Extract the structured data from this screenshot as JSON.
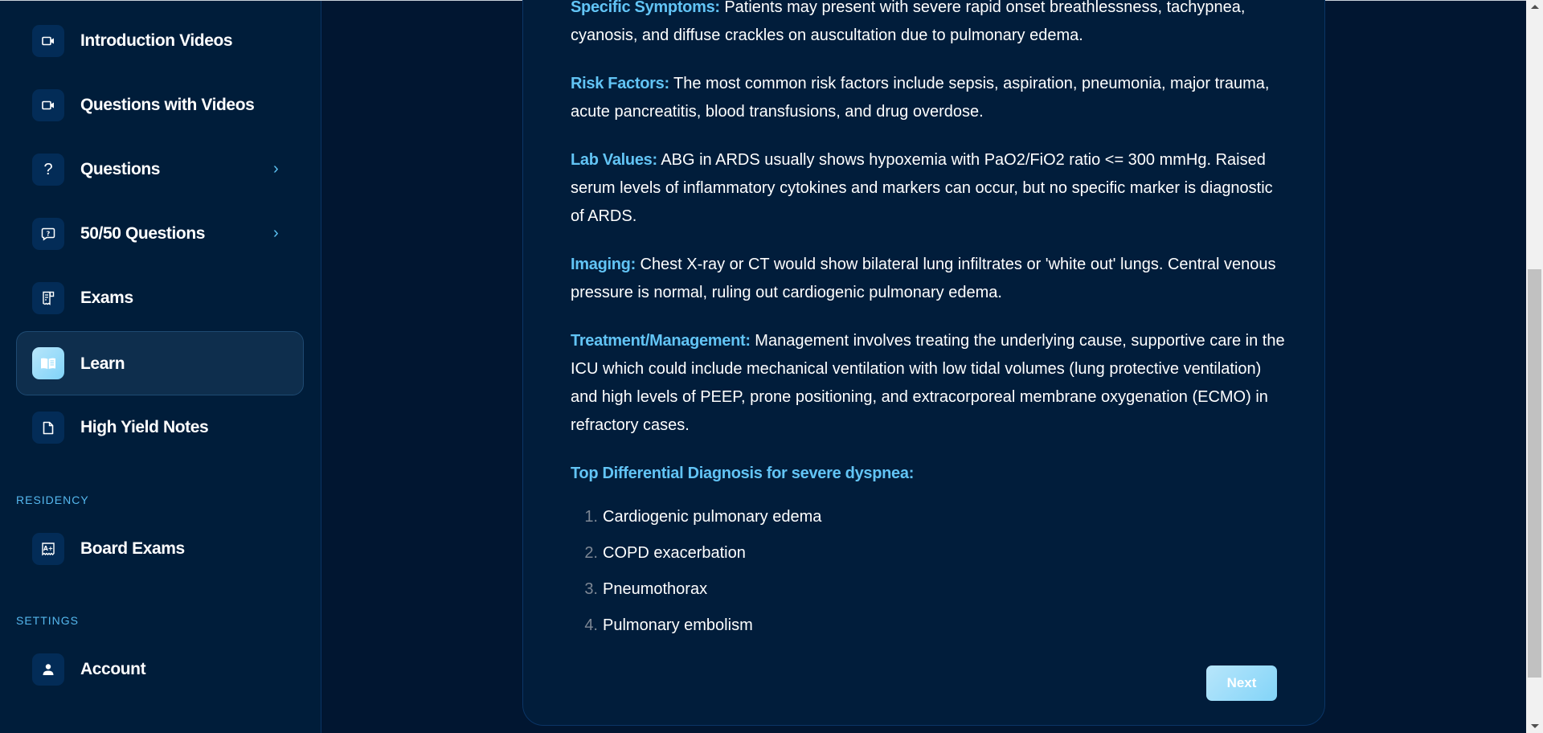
{
  "sidebar": {
    "items": [
      {
        "label": "Introduction Videos",
        "icon": "video-camera-icon",
        "has_chevron": false,
        "active": false
      },
      {
        "label": "Questions with Videos",
        "icon": "video-camera-icon",
        "has_chevron": false,
        "active": false
      },
      {
        "label": "Questions",
        "icon": "question-mark-icon",
        "has_chevron": true,
        "active": false
      },
      {
        "label": "50/50 Questions",
        "icon": "question-bubble-icon",
        "has_chevron": true,
        "active": false
      },
      {
        "label": "Exams",
        "icon": "exam-document-icon",
        "has_chevron": false,
        "active": false
      },
      {
        "label": "Learn",
        "icon": "open-book-icon",
        "has_chevron": false,
        "active": true
      },
      {
        "label": "High Yield Notes",
        "icon": "file-icon",
        "has_chevron": false,
        "active": false
      }
    ],
    "sections": [
      {
        "heading": "Residency",
        "items": [
          {
            "label": "Board Exams",
            "icon": "grade-certificate-icon"
          }
        ]
      },
      {
        "heading": "Settings",
        "items": [
          {
            "label": "Account",
            "icon": "user-icon"
          }
        ]
      }
    ],
    "chevron_glyph": "›"
  },
  "content": {
    "paragraphs": [
      {
        "label": "Specific Symptoms:",
        "text": " Patients may present with severe rapid onset breathlessness, tachypnea, cyanosis, and diffuse crackles on auscultation due to pulmonary edema."
      },
      {
        "label": "Risk Factors:",
        "text": " The most common risk factors include sepsis, aspiration, pneumonia, major trauma, acute pancreatitis, blood transfusions, and drug overdose."
      },
      {
        "label": "Lab Values:",
        "text": " ABG in ARDS usually shows hypoxemia with PaO2/FiO2 ratio <= 300 mmHg. Raised serum levels of inflammatory cytokines and markers can occur, but no specific marker is diagnostic of ARDS."
      },
      {
        "label": "Imaging:",
        "text": " Chest X-ray or CT would show bilateral lung infiltrates or 'white out' lungs. Central venous pressure is normal, ruling out cardiogenic pulmonary edema."
      },
      {
        "label": "Treatment/Management:",
        "text": " Management involves treating the underlying cause, supportive care in the ICU which could include mechanical ventilation with low tidal volumes (lung protective ventilation) and high levels of PEEP, prone positioning, and extracorporeal membrane oxygenation (ECMO) in refractory cases."
      }
    ],
    "differential_heading": "Top Differential Diagnosis for severe dyspnea:",
    "differentials": [
      {
        "num": "1.",
        "text": "Cardiogenic pulmonary edema"
      },
      {
        "num": "2.",
        "text": "COPD exacerbation"
      },
      {
        "num": "3.",
        "text": "Pneumothorax"
      },
      {
        "num": "4.",
        "text": "Pulmonary embolism"
      }
    ],
    "next_label": "Next"
  },
  "colors": {
    "accent": "#62c4f5",
    "page_bg": "#011631",
    "sidebar_bg": "#001d3a",
    "card_bg": "#011d3b",
    "button_gradient_start": "#b8e6fb",
    "button_gradient_end": "#82d4f8"
  }
}
